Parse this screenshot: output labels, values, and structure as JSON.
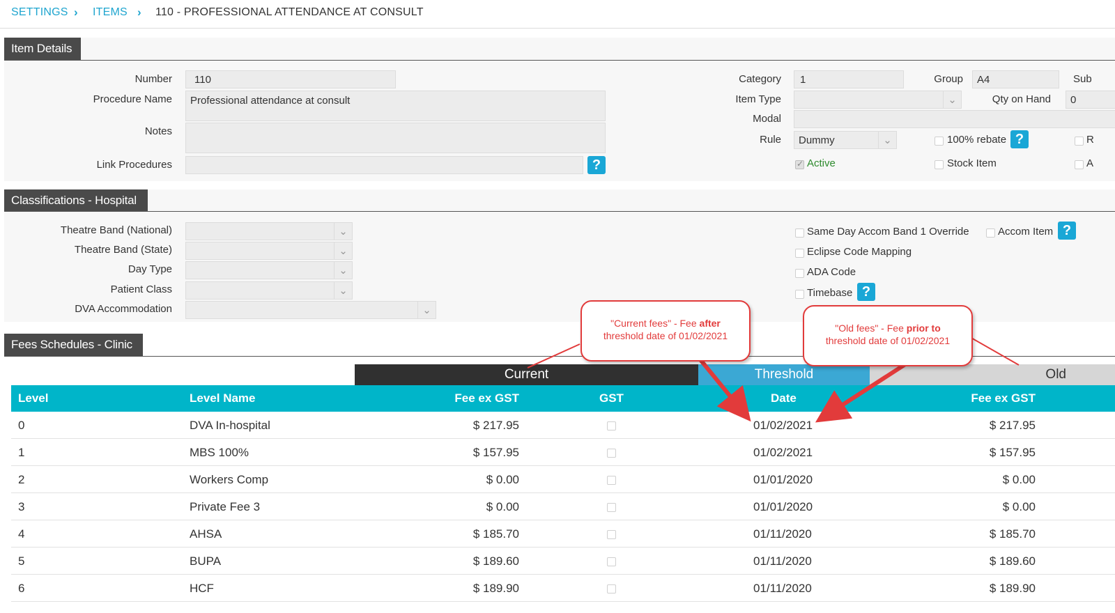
{
  "breadcrumb": {
    "settings": "SETTINGS",
    "items": "ITEMS",
    "current": "110 - PROFESSIONAL ATTENDANCE AT CONSULT"
  },
  "item_details": {
    "title": "Item Details",
    "number_label": "Number",
    "number_value": "110",
    "procedure_name_label": "Procedure Name",
    "procedure_name_value": "Professional attendance at consult",
    "notes_label": "Notes",
    "notes_value": "",
    "link_procedures_label": "Link Procedures",
    "link_procedures_value": "",
    "category_label": "Category",
    "category_value": "1",
    "group_label": "Group",
    "group_value": "A4",
    "sub_label": "Sub",
    "item_type_label": "Item Type",
    "item_type_value": "",
    "qty_on_hand_label": "Qty on Hand",
    "qty_on_hand_value": "0",
    "modal_label": "Modal",
    "modal_value": "",
    "rule_label": "Rule",
    "rule_value": "Dummy",
    "rebate_label": "100% rebate",
    "active_label": "Active",
    "stock_item_label": "Stock Item",
    "r_label": "R",
    "a_label": "A",
    "help_glyph": "?"
  },
  "classifications": {
    "title": "Classifications - Hospital",
    "theatre_band_national": "Theatre Band (National)",
    "theatre_band_state": "Theatre Band (State)",
    "day_type": "Day Type",
    "patient_class": "Patient Class",
    "dva_accommodation": "DVA Accommodation",
    "same_day_accom": "Same Day Accom Band 1 Override",
    "accom_item": "Accom Item",
    "eclipse_code": "Eclipse Code Mapping",
    "ada_code": "ADA Code",
    "timebase": "Timebase"
  },
  "fees": {
    "title": "Fees Schedules - Clinic",
    "group_current": "Current",
    "group_threshold": "Threshold",
    "group_old": "Old",
    "columns": {
      "level": "Level",
      "level_name": "Level Name",
      "fee_ex_gst": "Fee ex GST",
      "gst": "GST",
      "date": "Date",
      "old_fee_ex_gst": "Fee ex GST"
    },
    "rows": [
      {
        "level": "0",
        "name": "DVA In-hospital",
        "fee": "$ 217.95",
        "date": "01/02/2021",
        "old_fee": "$ 217.95"
      },
      {
        "level": "1",
        "name": "MBS 100%",
        "fee": "$ 157.95",
        "date": "01/02/2021",
        "old_fee": "$ 157.95"
      },
      {
        "level": "2",
        "name": "Workers Comp",
        "fee": "$ 0.00",
        "date": "01/01/2020",
        "old_fee": "$ 0.00"
      },
      {
        "level": "3",
        "name": "Private Fee 3",
        "fee": "$ 0.00",
        "date": "01/01/2020",
        "old_fee": "$ 0.00"
      },
      {
        "level": "4",
        "name": "AHSA",
        "fee": "$ 185.70",
        "date": "01/11/2020",
        "old_fee": "$ 185.70"
      },
      {
        "level": "5",
        "name": "BUPA",
        "fee": "$ 189.60",
        "date": "01/11/2020",
        "old_fee": "$ 189.60"
      },
      {
        "level": "6",
        "name": "HCF",
        "fee": "$ 189.90",
        "date": "01/11/2020",
        "old_fee": "$ 189.90"
      }
    ]
  },
  "callouts": {
    "current_a": "\"Current fees\" - Fee ",
    "current_b": "after",
    "current_c": "threshold date of 01/02/2021",
    "old_a": "\"Old fees\" - Fee ",
    "old_b": "prior to",
    "old_c": "threshold date of 01/02/2021"
  },
  "colors": {
    "accent": "#1fa5cf",
    "table_header": "#00b5c9",
    "section_header": "#4a4a4a",
    "callout_red": "#e23b3b",
    "active_green": "#2e8b2e"
  }
}
